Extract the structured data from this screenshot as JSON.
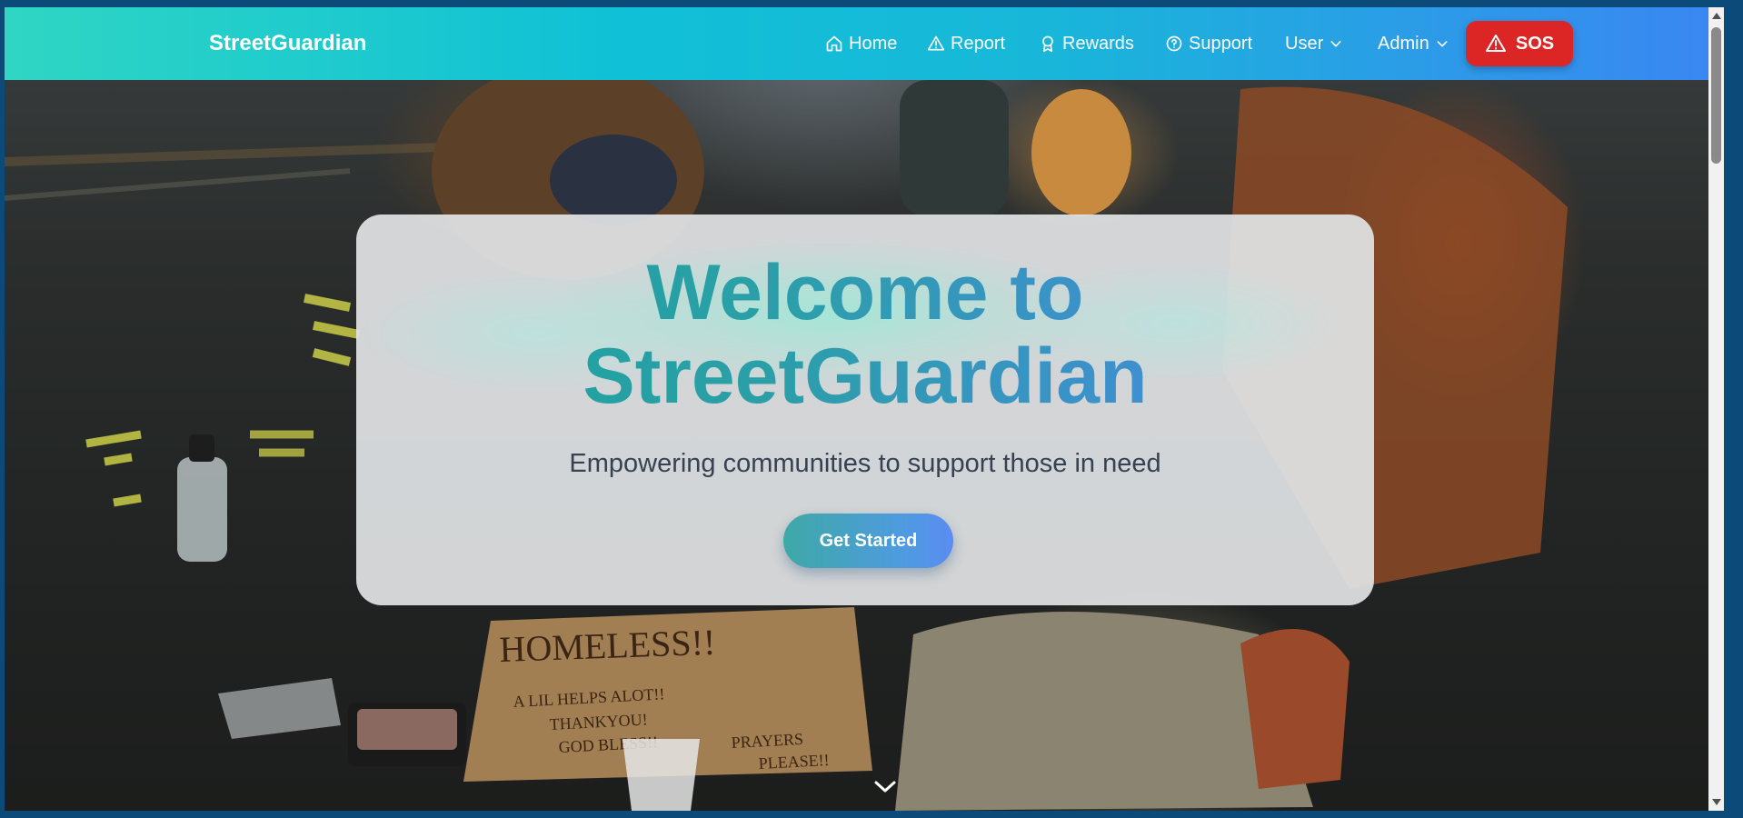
{
  "navbar": {
    "brand": "StreetGuardian",
    "items": [
      {
        "label": "Home",
        "icon": "home-icon"
      },
      {
        "label": "Report",
        "icon": "warning-triangle-icon"
      },
      {
        "label": "Rewards",
        "icon": "award-icon"
      },
      {
        "label": "Support",
        "icon": "help-circle-icon"
      },
      {
        "label": "User",
        "icon": "chevron-down-icon"
      },
      {
        "label": "Admin",
        "icon": "chevron-down-icon"
      }
    ],
    "sos_label": "SOS",
    "sos_icon": "alert-triangle-icon",
    "colors": {
      "gradient_start": "#2fd6c3",
      "gradient_end": "#3b86f2",
      "sos": "#dc2626"
    }
  },
  "hero": {
    "title_line1": "Welcome to",
    "title_line2": "StreetGuardian",
    "subtitle": "Empowering communities to support those in need",
    "cta_label": "Get Started",
    "scroll_icon": "chevron-down-icon",
    "title_colors": {
      "start": "#19a49a",
      "end": "#4a86e6"
    }
  }
}
